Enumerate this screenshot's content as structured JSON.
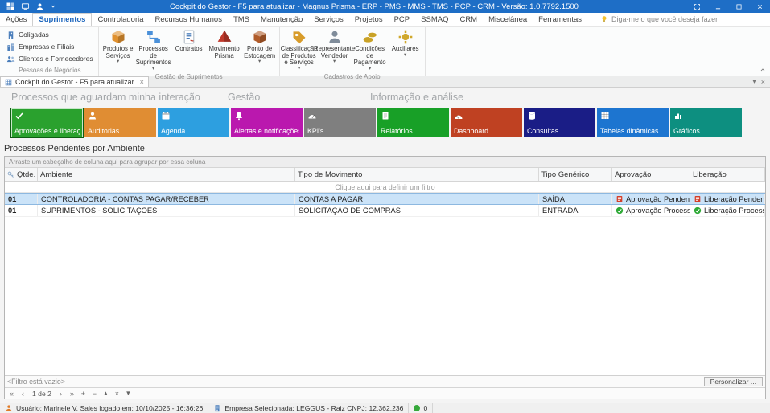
{
  "colors": {
    "titlebar": "#1e6ec6",
    "selection": "#cbe3f8",
    "pending": "#d33e2a",
    "processed": "#2faa37"
  },
  "window": {
    "title": "Cockpit do Gestor - F5 para atualizar - Magnus Prisma - ERP - PMS - MMS - TMS - PCP - CRM -  Versão: 1.0.7792.1500"
  },
  "ribbon": {
    "tellme": "Diga-me o que você deseja fazer",
    "tabs": [
      {
        "label": "Ações"
      },
      {
        "label": "Suprimentos",
        "active": true
      },
      {
        "label": "Controladoria"
      },
      {
        "label": "Recursos Humanos"
      },
      {
        "label": "TMS"
      },
      {
        "label": "Manutenção"
      },
      {
        "label": "Serviços"
      },
      {
        "label": "Projetos"
      },
      {
        "label": "PCP"
      },
      {
        "label": "SSMAQ"
      },
      {
        "label": "CRM"
      },
      {
        "label": "Miscelânea"
      },
      {
        "label": "Ferramentas"
      }
    ],
    "groups": [
      {
        "label": "Pessoas de Negócios",
        "type": "small",
        "items": [
          {
            "label": "Coligadas",
            "icon": "building-icon",
            "color": "#4a7ebb"
          },
          {
            "label": "Empresas e Filiais",
            "icon": "buildings-icon",
            "color": "#4a7ebb"
          },
          {
            "label": "Clientes e Fornecedores",
            "icon": "people-icon",
            "color": "#4a7ebb"
          }
        ]
      },
      {
        "label": "Gestão de Suprimentos",
        "type": "large",
        "items": [
          {
            "label": "Produtos e Serviços",
            "icon": "cube-icon",
            "color": "#e0912f",
            "dropdown": true
          },
          {
            "label": "Processos de Suprimentos",
            "icon": "flow-icon",
            "color": "#4a90d9",
            "dropdown": true
          },
          {
            "label": "Contratos",
            "icon": "contract-icon",
            "color": "#4a7ebb",
            "dropdown": false
          },
          {
            "label": "Movimento Prisma",
            "icon": "prism-icon",
            "color": "#c0392b",
            "dropdown": false
          },
          {
            "label": "Ponto de Estocagem",
            "icon": "cube-icon",
            "color": "#b05c2a",
            "dropdown": true
          }
        ]
      },
      {
        "label": "Cadastros de Apoio",
        "type": "large",
        "items": [
          {
            "label": "Classificação de Produtos e Serviços",
            "icon": "tags-icon",
            "color": "#d89c2a",
            "dropdown": true
          },
          {
            "label": "Representante Vendedor",
            "icon": "person-icon",
            "color": "#7f8c9a",
            "dropdown": true
          },
          {
            "label": "Condições de Pagamento",
            "icon": "coins-icon",
            "color": "#c9a227",
            "dropdown": true
          },
          {
            "label": "Auxiliares",
            "icon": "gear-icon",
            "color": "#d0a82c",
            "dropdown": true
          }
        ]
      }
    ]
  },
  "doc_tab": {
    "label": "Cockpit do Gestor - F5 para atualizar"
  },
  "sections": [
    {
      "label": "Processos que aguardam minha interação"
    },
    {
      "label": "Gestão"
    },
    {
      "label": "Informação e análise"
    }
  ],
  "tiles": [
    {
      "label": "Aprovações e liberaç...",
      "color": "#2aa12e",
      "icon": "check-icon",
      "selected": true
    },
    {
      "label": "Auditorias",
      "color": "#e08d33",
      "icon": "person-icon"
    },
    {
      "label": "Agenda",
      "color": "#2d9fe0",
      "icon": "calendar-icon"
    },
    {
      "label": "Alertas e notificações",
      "color": "#ba18ae",
      "icon": "bell-icon"
    },
    {
      "label": "KPI's",
      "color": "#7f7f7f",
      "icon": "gauge-icon"
    },
    {
      "label": "Relatórios",
      "color": "#18a027",
      "icon": "report-icon"
    },
    {
      "label": "Dashboard",
      "color": "#bf4122",
      "icon": "dashboard-icon"
    },
    {
      "label": "Consultas",
      "color": "#1a1d86",
      "icon": "database-icon"
    },
    {
      "label": "Tabelas dinâmicas",
      "color": "#1d75d0",
      "icon": "table-icon"
    },
    {
      "label": "Gráficos",
      "color": "#0d8f80",
      "icon": "chart-icon"
    }
  ],
  "grid": {
    "title": "Processos Pendentes por Ambiente",
    "group_hint": "Arraste um cabeçalho de coluna aqui para agrupar por essa coluna",
    "columns": [
      "Qtde.",
      "Ambiente",
      "Tipo de Movimento",
      "Tipo Genérico",
      "Aprovação",
      "Liberação"
    ],
    "filter_hint": "Clique aqui para definir um filtro",
    "rows": [
      {
        "qtde": "01",
        "ambiente": "CONTROLADORIA - CONTAS PAGAR/RECEBER",
        "tipo_movimento": "CONTAS A PAGAR",
        "tipo_generico": "SAÍDA",
        "aprovacao": {
          "status": "pending",
          "label": "Aprovação Pendente"
        },
        "liberacao": {
          "status": "pending",
          "label": "Liberação Pendente"
        },
        "selected": true
      },
      {
        "qtde": "01",
        "ambiente": "SUPRIMENTOS - SOLICITAÇÕES",
        "tipo_movimento": "SOLICITAÇÃO DE COMPRAS",
        "tipo_generico": "ENTRADA",
        "aprovacao": {
          "status": "processed",
          "label": "Aprovação Processada"
        },
        "liberacao": {
          "status": "processed",
          "label": "Liberação Processada"
        },
        "selected": false
      }
    ],
    "footer": {
      "filter_text": "<Filtro está vazio>",
      "customize_label": "Personalizar ..."
    },
    "pager": {
      "text": "1 de 2",
      "left_buttons": [
        {
          "name": "first-record-button",
          "glyph": "«"
        },
        {
          "name": "previous-record-button",
          "glyph": "‹"
        }
      ],
      "right_buttons": [
        {
          "name": "next-record-button",
          "glyph": "›"
        },
        {
          "name": "last-record-button",
          "glyph": "»"
        },
        {
          "name": "append-record-button",
          "glyph": "+"
        },
        {
          "name": "delete-record-button",
          "glyph": "−"
        },
        {
          "name": "edit-record-button",
          "glyph": "▴"
        },
        {
          "name": "cancel-edit-button",
          "glyph": "×"
        },
        {
          "name": "filter-records-button",
          "glyph": "▾"
        }
      ]
    }
  },
  "statusbar": {
    "user": "Usuário: Marinele V. Sales  logado em: 10/10/2025 - 16:36:26",
    "company": "Empresa Selecionada: LEGGUS - Raiz CNPJ: 12.362.236",
    "counter": "0"
  },
  "chrome_icons": {
    "dropdown": "▾",
    "close": "×",
    "collapse": "^"
  }
}
